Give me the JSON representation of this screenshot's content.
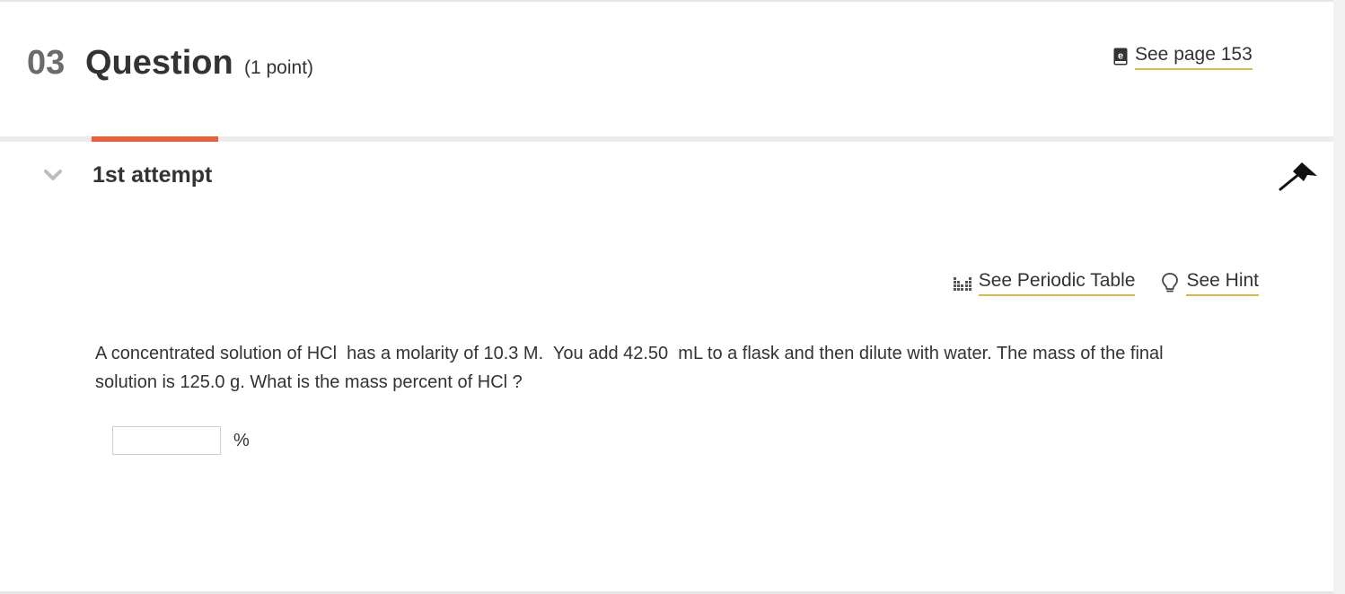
{
  "header": {
    "number": "03",
    "title": "Question",
    "points": "(1 point)",
    "page_link": "See page 153",
    "page_icon": "ebook-icon"
  },
  "attempt": {
    "label": "1st attempt",
    "toggle_icon": "chevron-down-icon",
    "flag_icon": "flag-icon"
  },
  "tools": {
    "periodic_table": "See Periodic Table",
    "periodic_table_icon": "periodic-table-icon",
    "hint": "See Hint",
    "hint_icon": "lightbulb-icon"
  },
  "question": {
    "text_line1": "A concentrated solution of HCl  has a molarity of 10.3 M.  You add 42.50  mL to a flask and then dilute with water. The mass of the final",
    "text_line2": "solution is 125.0 g. What is the mass percent of HCl ?",
    "answer_value": "",
    "answer_unit": "%"
  },
  "colors": {
    "accent_underline": "#e8603c",
    "link_underline": "#d9b84a",
    "text": "#333333",
    "number": "#6b6b6b"
  }
}
